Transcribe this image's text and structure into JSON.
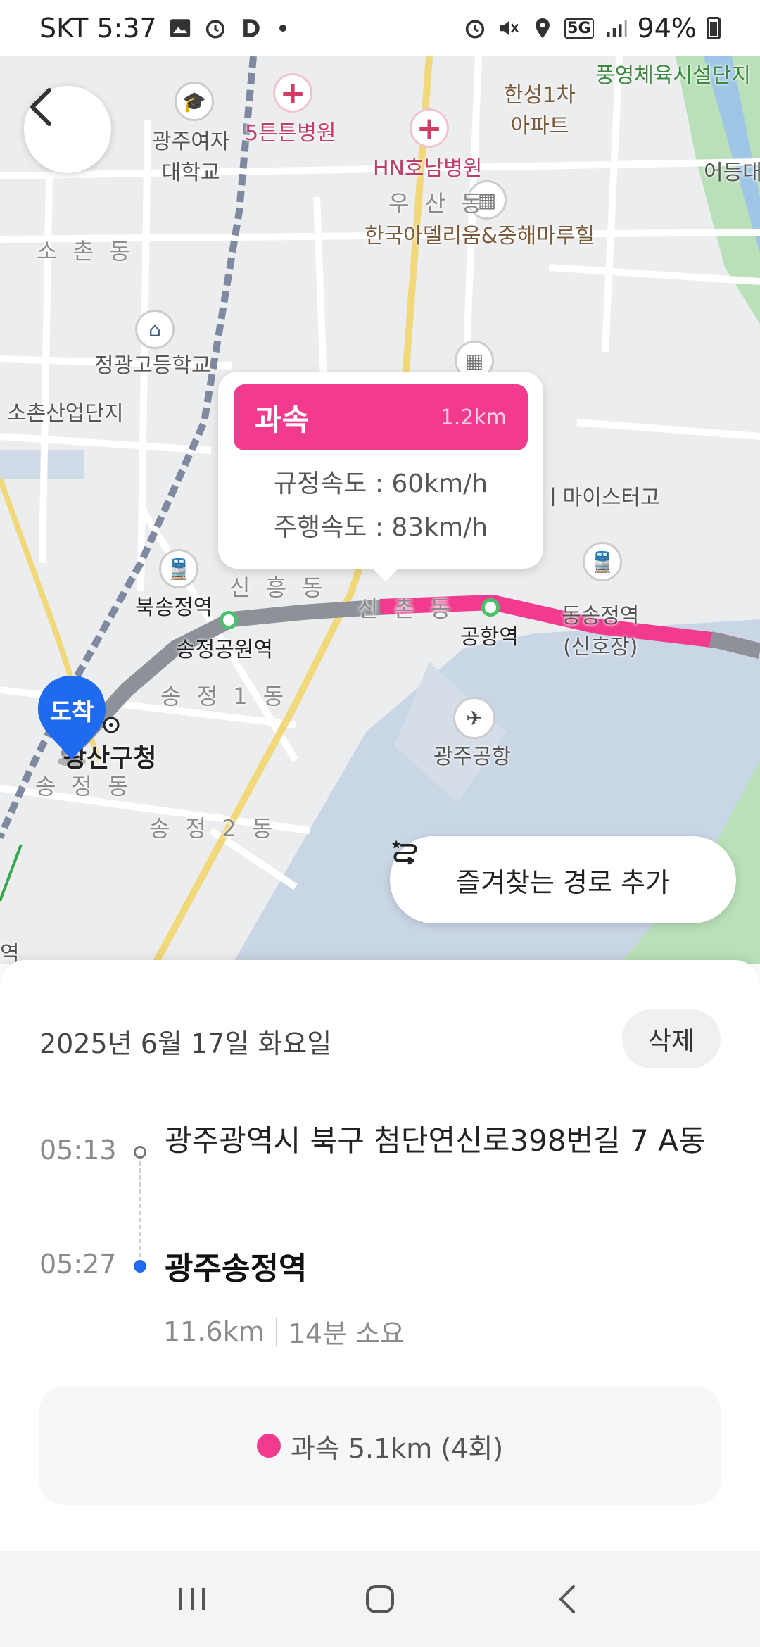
{
  "status_bar": {
    "carrier_time": "SKT 5:37",
    "network": "5G",
    "battery": "94%"
  },
  "map": {
    "labels": {
      "womens_univ": "광주여자\n대학교",
      "hospital_1": "5튼튼병원",
      "hospital_2": "HN호남병원",
      "apartment_1": "한성1차\n아파트",
      "sports_facility": "풍영체육시설단지",
      "eodeung": "어등대",
      "usan": "우 산 동",
      "apartment_2": "한국아델리움&중해마루힐",
      "sochon": "소 촌 동",
      "jeonggwang_school": "정광고등학교",
      "sochon_industrial": "소촌산업단지",
      "mystery_school": "ㅣ마이스터고",
      "sinheung": "신 흥 동",
      "buksongjeong": "북송정역",
      "songjeong_park": "송정공원역",
      "sinchon": "신 촌 동",
      "airport_station": "공항역",
      "dongsongjeong": "동송정역\n(신호장)",
      "songjeong1": "송 정 1 동",
      "gwangsan_office": "광산구청",
      "songjeong_dong": "송 정 동",
      "songjeong2": "송 정 2 동",
      "gwangju_airport": "광주공항",
      "station_edge": "역"
    },
    "tooltip": {
      "title": "과속",
      "distance": "1.2km",
      "speed_limit": "규정속도 : 60km/h",
      "driving_speed": "주행속도 : 83km/h"
    },
    "destination_pin": "도착",
    "favorite_route_button": "즐겨찾는 경로 추가",
    "colors": {
      "route_gray": "#8e9198",
      "speeding_pink": "#f23a8e",
      "water": "#c9d6e6",
      "park": "#b9e0b8"
    }
  },
  "trip": {
    "date": "2025년 6월 17일 화요일",
    "delete_label": "삭제",
    "origin_time": "05:13",
    "origin_address": "광주광역시 북구 첨단연신로398번길 7 A동",
    "dest_time": "05:27",
    "dest_name": "광주송정역",
    "distance": "11.6km",
    "duration": "14분 소요",
    "speeding_summary": "과속 5.1km (4회)"
  },
  "icons": {
    "back": "chevron-left-icon",
    "favorite_route": "route-star-icon",
    "recents": "recents-icon",
    "home": "home-icon",
    "nav_back": "back-icon"
  }
}
